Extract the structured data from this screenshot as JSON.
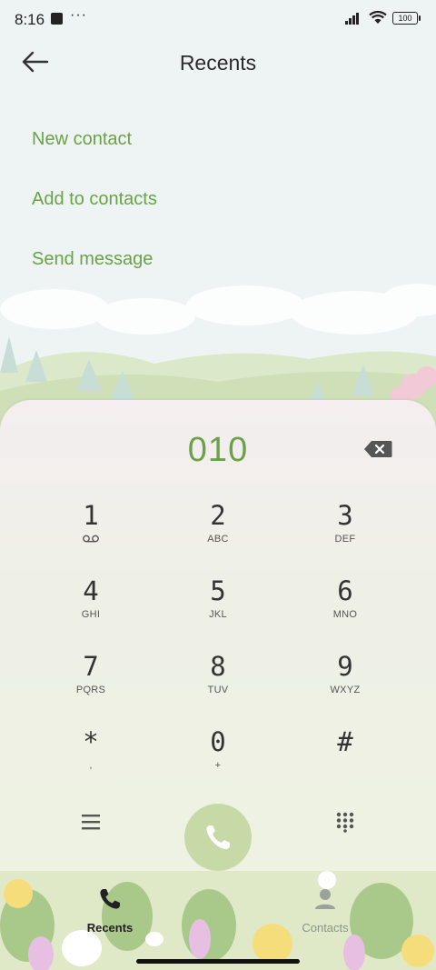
{
  "status": {
    "time": "8:16",
    "dots": "···",
    "battery": "100"
  },
  "header": {
    "title": "Recents"
  },
  "actions": [
    {
      "label": "New contact"
    },
    {
      "label": "Add to contacts"
    },
    {
      "label": "Send message"
    }
  ],
  "dialer": {
    "number": "010",
    "keys": [
      {
        "digit": "1",
        "letters": ""
      },
      {
        "digit": "2",
        "letters": "ABC"
      },
      {
        "digit": "3",
        "letters": "DEF"
      },
      {
        "digit": "4",
        "letters": "GHI"
      },
      {
        "digit": "5",
        "letters": "JKL"
      },
      {
        "digit": "6",
        "letters": "MNO"
      },
      {
        "digit": "7",
        "letters": "PQRS"
      },
      {
        "digit": "8",
        "letters": "TUV"
      },
      {
        "digit": "9",
        "letters": "WXYZ"
      },
      {
        "digit": "*",
        "letters": ","
      },
      {
        "digit": "0",
        "letters": "+"
      },
      {
        "digit": "#",
        "letters": ""
      }
    ]
  },
  "nav": {
    "recents": "Recents",
    "contacts": "Contacts"
  },
  "colors": {
    "accent": "#6aa245",
    "call": "#c8d9a8"
  },
  "icons": [
    "back-arrow-icon",
    "backspace-icon",
    "voicemail-icon",
    "menu-icon",
    "phone-icon",
    "dialpad-icon",
    "person-icon"
  ]
}
